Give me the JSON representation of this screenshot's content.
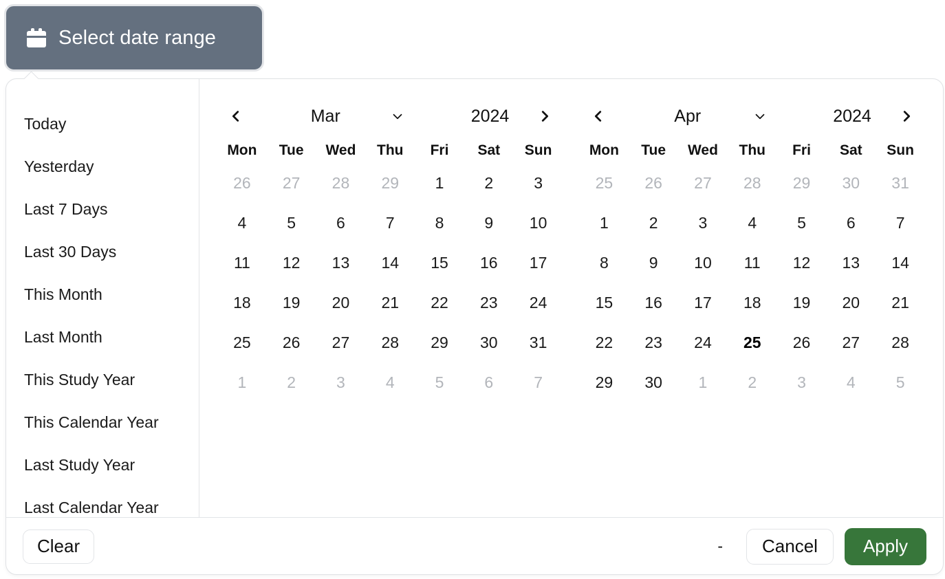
{
  "trigger": {
    "label": "Select date range",
    "icon": "calendar-icon",
    "background_color": "#64707f",
    "text_color": "#ffffff"
  },
  "presets": [
    {
      "label": "Today"
    },
    {
      "label": "Yesterday"
    },
    {
      "label": "Last 7 Days"
    },
    {
      "label": "Last 30 Days"
    },
    {
      "label": "This Month"
    },
    {
      "label": "Last Month"
    },
    {
      "label": "This Study Year"
    },
    {
      "label": "This Calendar Year"
    },
    {
      "label": "Last Study Year"
    },
    {
      "label": "Last Calendar Year"
    }
  ],
  "weekdays": [
    "Mon",
    "Tue",
    "Wed",
    "Thu",
    "Fri",
    "Sat",
    "Sun"
  ],
  "calendars": [
    {
      "month": "Mar",
      "year": "2024",
      "prev_icon": "chevron-left-icon",
      "next_icon": "chevron-right-icon",
      "dropdown_icon": "chevron-down-icon",
      "weeks": [
        [
          {
            "n": "26",
            "muted": true
          },
          {
            "n": "27",
            "muted": true
          },
          {
            "n": "28",
            "muted": true
          },
          {
            "n": "29",
            "muted": true
          },
          {
            "n": "1",
            "muted": false
          },
          {
            "n": "2",
            "muted": false
          },
          {
            "n": "3",
            "muted": false
          }
        ],
        [
          {
            "n": "4",
            "muted": false
          },
          {
            "n": "5",
            "muted": false
          },
          {
            "n": "6",
            "muted": false
          },
          {
            "n": "7",
            "muted": false
          },
          {
            "n": "8",
            "muted": false
          },
          {
            "n": "9",
            "muted": false
          },
          {
            "n": "10",
            "muted": false
          }
        ],
        [
          {
            "n": "11",
            "muted": false
          },
          {
            "n": "12",
            "muted": false
          },
          {
            "n": "13",
            "muted": false
          },
          {
            "n": "14",
            "muted": false
          },
          {
            "n": "15",
            "muted": false
          },
          {
            "n": "16",
            "muted": false
          },
          {
            "n": "17",
            "muted": false
          }
        ],
        [
          {
            "n": "18",
            "muted": false
          },
          {
            "n": "19",
            "muted": false
          },
          {
            "n": "20",
            "muted": false
          },
          {
            "n": "21",
            "muted": false
          },
          {
            "n": "22",
            "muted": false
          },
          {
            "n": "23",
            "muted": false
          },
          {
            "n": "24",
            "muted": false
          }
        ],
        [
          {
            "n": "25",
            "muted": false
          },
          {
            "n": "26",
            "muted": false
          },
          {
            "n": "27",
            "muted": false
          },
          {
            "n": "28",
            "muted": false
          },
          {
            "n": "29",
            "muted": false
          },
          {
            "n": "30",
            "muted": false
          },
          {
            "n": "31",
            "muted": false
          }
        ],
        [
          {
            "n": "1",
            "muted": true
          },
          {
            "n": "2",
            "muted": true
          },
          {
            "n": "3",
            "muted": true
          },
          {
            "n": "4",
            "muted": true
          },
          {
            "n": "5",
            "muted": true
          },
          {
            "n": "6",
            "muted": true
          },
          {
            "n": "7",
            "muted": true
          }
        ]
      ]
    },
    {
      "month": "Apr",
      "year": "2024",
      "prev_icon": "chevron-left-icon",
      "next_icon": "chevron-right-icon",
      "dropdown_icon": "chevron-down-icon",
      "weeks": [
        [
          {
            "n": "25",
            "muted": true
          },
          {
            "n": "26",
            "muted": true
          },
          {
            "n": "27",
            "muted": true
          },
          {
            "n": "28",
            "muted": true
          },
          {
            "n": "29",
            "muted": true
          },
          {
            "n": "30",
            "muted": true
          },
          {
            "n": "31",
            "muted": true
          }
        ],
        [
          {
            "n": "1",
            "muted": false
          },
          {
            "n": "2",
            "muted": false
          },
          {
            "n": "3",
            "muted": false
          },
          {
            "n": "4",
            "muted": false
          },
          {
            "n": "5",
            "muted": false
          },
          {
            "n": "6",
            "muted": false
          },
          {
            "n": "7",
            "muted": false
          }
        ],
        [
          {
            "n": "8",
            "muted": false
          },
          {
            "n": "9",
            "muted": false
          },
          {
            "n": "10",
            "muted": false
          },
          {
            "n": "11",
            "muted": false
          },
          {
            "n": "12",
            "muted": false
          },
          {
            "n": "13",
            "muted": false
          },
          {
            "n": "14",
            "muted": false
          }
        ],
        [
          {
            "n": "15",
            "muted": false
          },
          {
            "n": "16",
            "muted": false
          },
          {
            "n": "17",
            "muted": false
          },
          {
            "n": "18",
            "muted": false
          },
          {
            "n": "19",
            "muted": false
          },
          {
            "n": "20",
            "muted": false
          },
          {
            "n": "21",
            "muted": false
          }
        ],
        [
          {
            "n": "22",
            "muted": false
          },
          {
            "n": "23",
            "muted": false
          },
          {
            "n": "24",
            "muted": false
          },
          {
            "n": "25",
            "muted": false,
            "today": true
          },
          {
            "n": "26",
            "muted": false
          },
          {
            "n": "27",
            "muted": false
          },
          {
            "n": "28",
            "muted": false
          }
        ],
        [
          {
            "n": "29",
            "muted": false
          },
          {
            "n": "30",
            "muted": false
          },
          {
            "n": "1",
            "muted": true
          },
          {
            "n": "2",
            "muted": true
          },
          {
            "n": "3",
            "muted": true
          },
          {
            "n": "4",
            "muted": true
          },
          {
            "n": "5",
            "muted": true
          }
        ]
      ]
    }
  ],
  "footer": {
    "clear_label": "Clear",
    "range_separator": "-",
    "cancel_label": "Cancel",
    "apply_label": "Apply",
    "apply_color": "#37763a"
  }
}
